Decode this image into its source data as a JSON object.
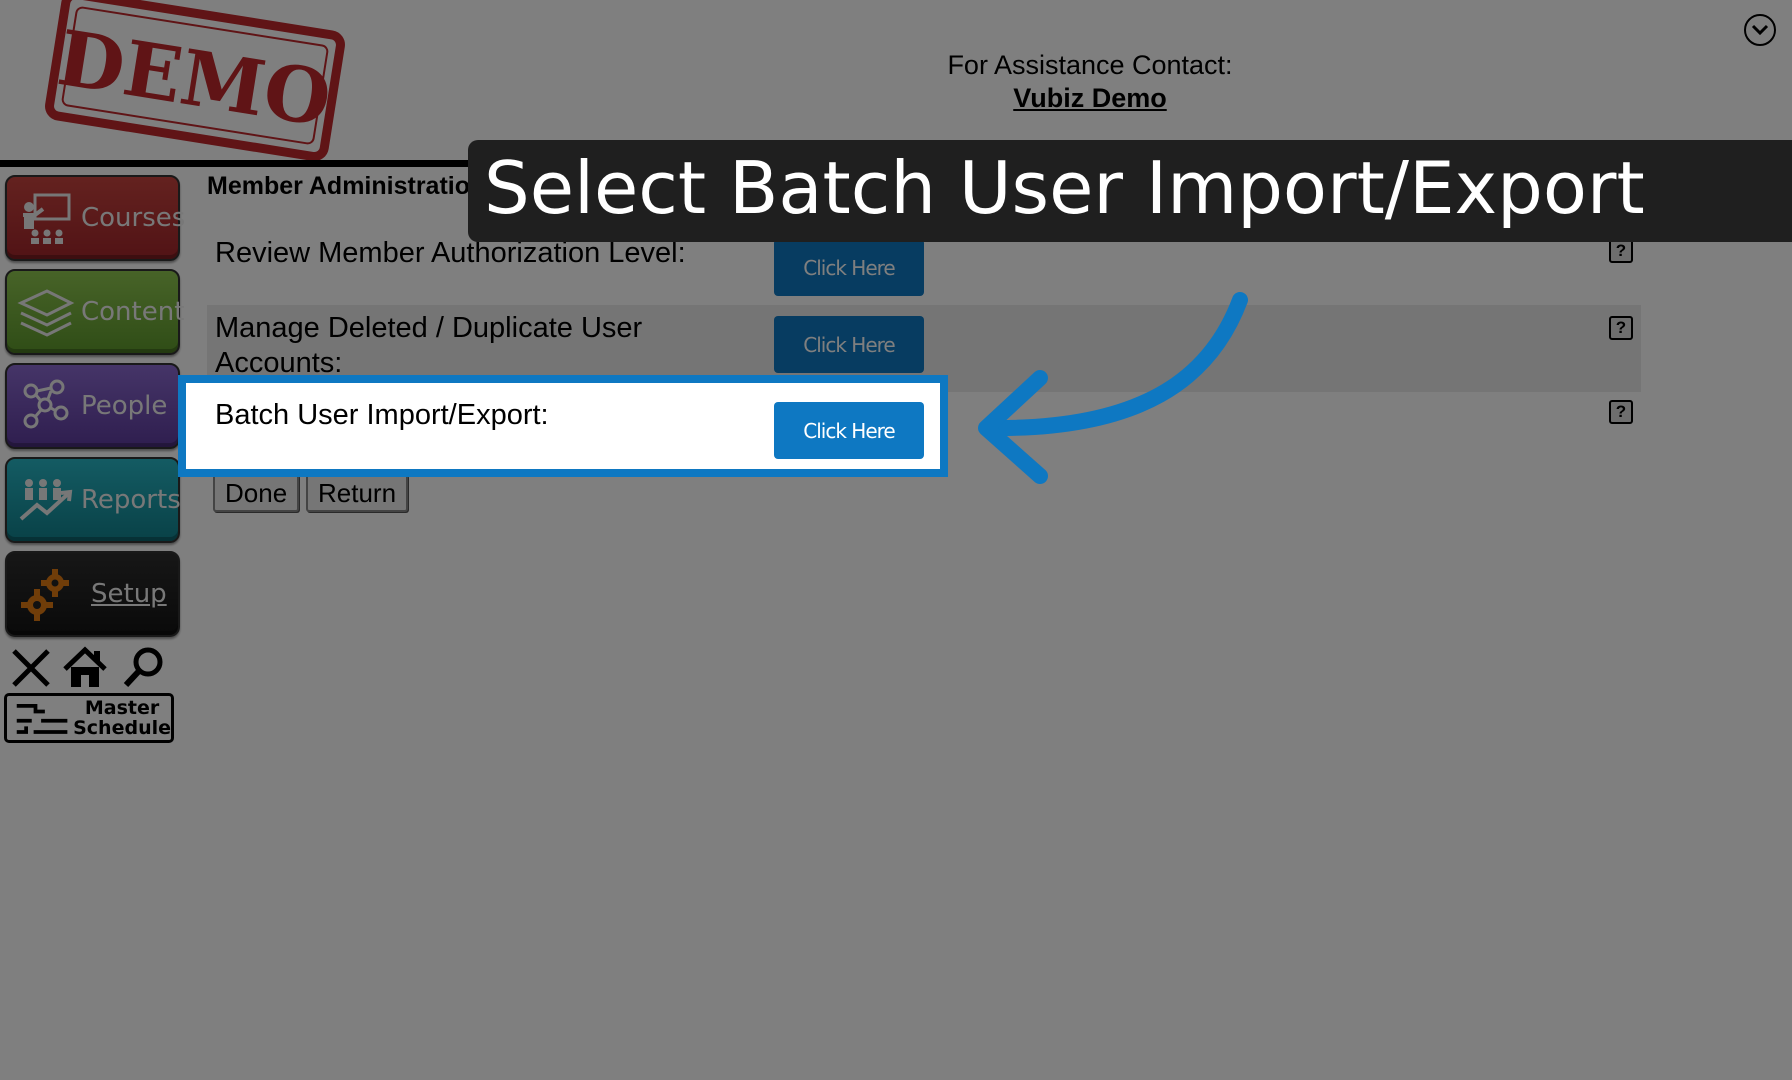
{
  "header": {
    "stamp_text": "DEMO",
    "assist_label": "For Assistance Contact:",
    "assist_link": "Vubiz Demo"
  },
  "sidebar": {
    "items": [
      {
        "label": "Courses"
      },
      {
        "label": "Content"
      },
      {
        "label": "People"
      },
      {
        "label": "Reports"
      },
      {
        "label": "Setup"
      }
    ],
    "master_line1": "Master",
    "master_line2": "Schedule"
  },
  "main": {
    "title": "Member Administration",
    "rows": [
      {
        "label": "Review Member Authorization Level:",
        "button": "Click Here"
      },
      {
        "label_line1": "Manage Deleted / Duplicate User",
        "label_line2": "Accounts:",
        "button": "Click Here"
      },
      {
        "label": "Batch User Import/Export:",
        "button": "Click Here"
      }
    ],
    "help_symbol": "?",
    "done_label": "Done",
    "return_label": "Return"
  },
  "overlay": {
    "callout": "Select Batch User Import/Export"
  },
  "colors": {
    "accent": "#0e78c2",
    "courses": "#b3322f",
    "content": "#74ae3a",
    "people": "#6f4fb6",
    "reports": "#1aa0ad",
    "setup": "#222222"
  }
}
